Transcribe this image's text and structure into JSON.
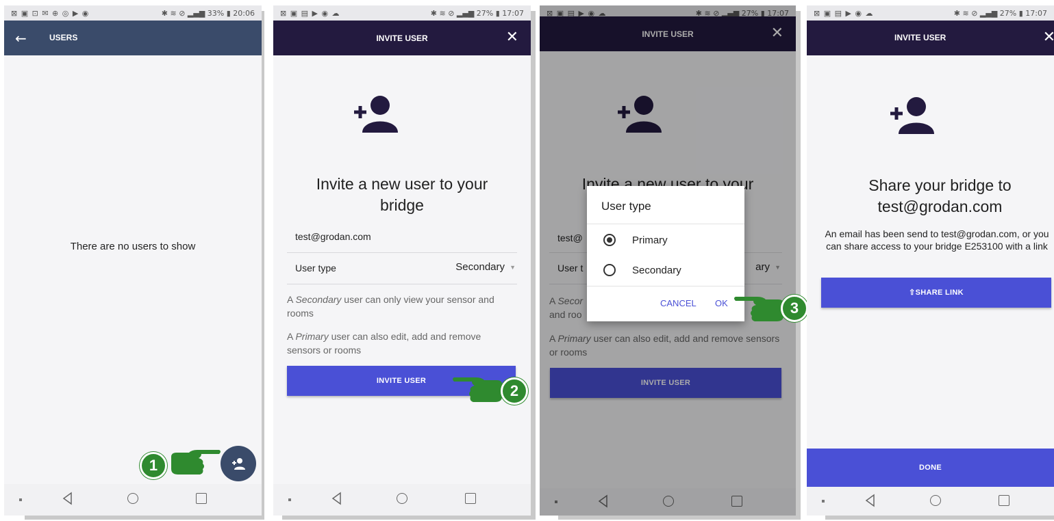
{
  "screen1": {
    "status_left": "⊠ ▣ ⊡ ✉ ⊕ ◎ ▶ ◉",
    "status_right": "✱ ≋ ⊘ ▂▄▆ 33% ▮ 20:06",
    "title": "USERS",
    "empty_text": "There are no users to show",
    "step_number": "1"
  },
  "screen2": {
    "status_left": "⊠ ▣ ▤ ▶ ◉ ☁",
    "status_right": "✱ ≋ ⊘ ▂▄▆ 27% ▮ 17:07",
    "title": "INVITE USER",
    "heading_line1": "Invite a new user to your",
    "heading_line2": "bridge",
    "email_value": "test@grodan.com",
    "user_type_label": "User type",
    "user_type_value": "Secondary",
    "hint_secondary_prefix": "A ",
    "hint_secondary_em": "Secondary",
    "hint_secondary_rest": " user can only view your sensor and rooms",
    "hint_primary_prefix": "A ",
    "hint_primary_em": "Primary",
    "hint_primary_rest": " user can also edit, add and remove sensors or rooms",
    "invite_button": "INVITE USER",
    "step_number": "2"
  },
  "screen3": {
    "status_left": "⊠ ▣ ▤ ▶ ◉ ☁",
    "status_right": "✱ ≋ ⊘ ▂▄▆ 27% ▮ 17:07",
    "title": "INVITE USER",
    "heading_partial": "Invite a new user to your",
    "email_partial": "test@",
    "user_type_partial": "User t",
    "user_type_value_partial": "ary",
    "hint_secondary_prefix": "A ",
    "hint_secondary_em": "Secor",
    "hint_secondary_rest": "and roo",
    "hint_primary_prefix": "A ",
    "hint_primary_em": "Primary",
    "hint_primary_rest": " user can also edit, add and remove sensors or rooms",
    "invite_button": "INVITE USER",
    "dialog_title": "User type",
    "option_primary": "Primary",
    "option_secondary": "Secondary",
    "cancel": "CANCEL",
    "ok": "OK",
    "step_number": "3"
  },
  "screen4": {
    "status_left": "⊠ ▣ ▤ ▶ ◉ ☁",
    "status_right": "✱ ≋ ⊘ ▂▄▆ 27% ▮ 17:07",
    "title": "INVITE USER",
    "heading_line1": "Share your bridge to",
    "heading_line2": "test@grodan.com",
    "body_text": "An email has been send to test@grodan.com, or you can share access to your bridge E253100 with a link",
    "share_button": "SHARE LINK",
    "done_button": "DONE"
  },
  "colors": {
    "appbar_blue": "#3a4b6a",
    "appbar_purple": "#231a3f",
    "accent": "#4a50d6",
    "step_green": "#2f8a2f"
  }
}
